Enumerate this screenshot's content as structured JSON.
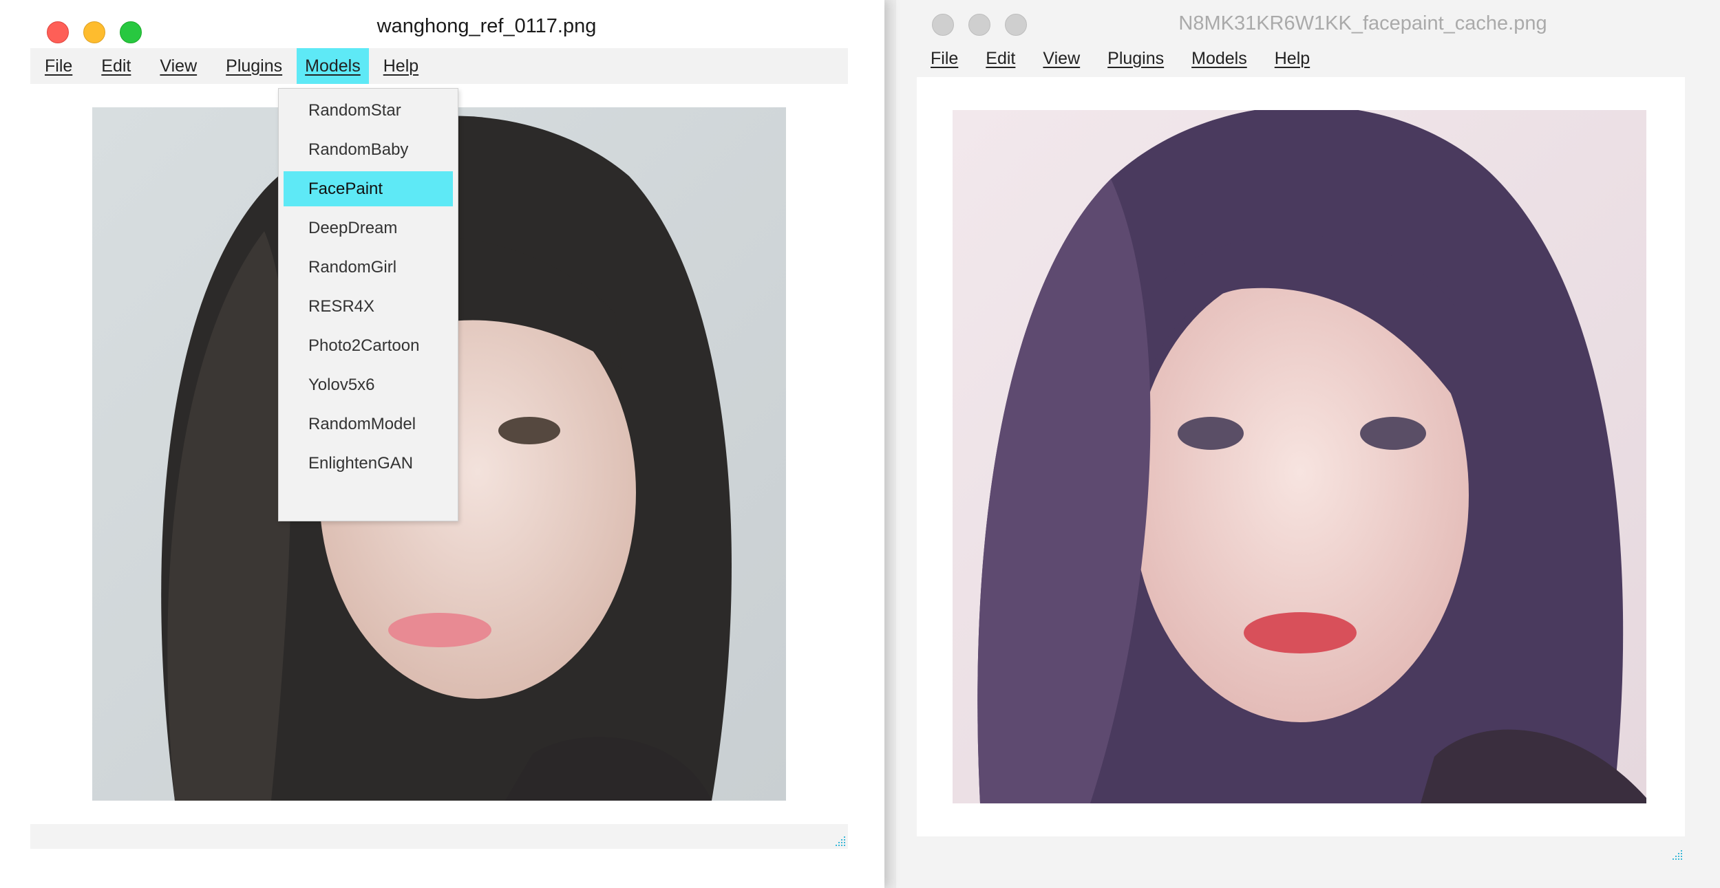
{
  "left_window": {
    "title": "wanghong_ref_0117.png",
    "menu": [
      "File",
      "Edit",
      "View",
      "Plugins",
      "Models",
      "Help"
    ],
    "active_menu": "Models",
    "models_menu": {
      "items": [
        "RandomStar",
        "RandomBaby",
        "FacePaint",
        "DeepDream",
        "RandomGirl",
        "RESR4X",
        "Photo2Cartoon",
        "Yolov5x6",
        "RandomModel",
        "EnlightenGAN"
      ],
      "selected": "FacePaint"
    },
    "image_subject": "photo-portrait"
  },
  "right_window": {
    "title": "N8MK31KR6W1KK_facepaint_cache.png",
    "menu": [
      "File",
      "Edit",
      "View",
      "Plugins",
      "Models",
      "Help"
    ],
    "image_subject": "painted-portrait"
  },
  "colors": {
    "highlight": "#5ee9f6",
    "close": "#fe5f57",
    "minimize": "#febc2e",
    "zoom": "#28c840",
    "inactive_light": "#cfcfcf"
  }
}
